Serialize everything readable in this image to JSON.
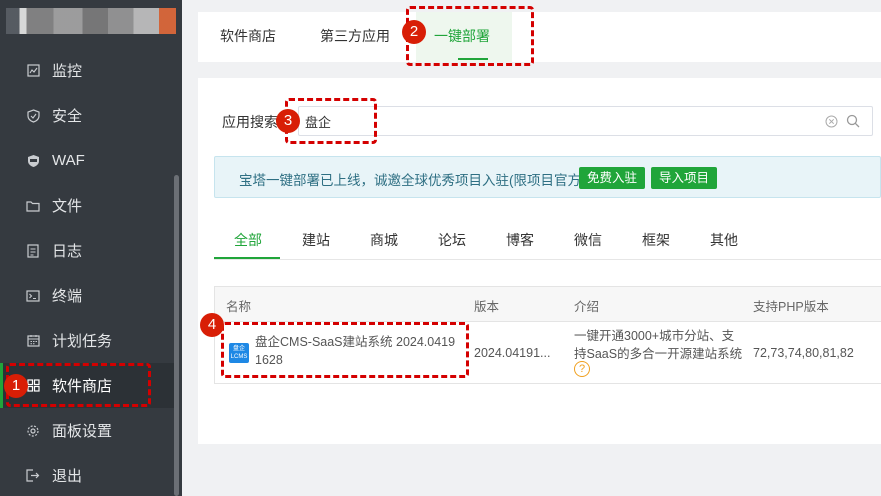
{
  "sidebar": {
    "items": [
      {
        "label": "监控",
        "icon": "monitor-icon"
      },
      {
        "label": "安全",
        "icon": "shield-icon"
      },
      {
        "label": "WAF",
        "icon": "waf-shield-icon"
      },
      {
        "label": "文件",
        "icon": "folder-icon"
      },
      {
        "label": "日志",
        "icon": "log-icon"
      },
      {
        "label": "终端",
        "icon": "terminal-icon"
      },
      {
        "label": "计划任务",
        "icon": "calendar-icon"
      },
      {
        "label": "软件商店",
        "icon": "grid-icon"
      },
      {
        "label": "面板设置",
        "icon": "gear-icon"
      },
      {
        "label": "退出",
        "icon": "logout-icon"
      }
    ]
  },
  "tabs": [
    {
      "label": "软件商店"
    },
    {
      "label": "第三方应用"
    },
    {
      "label": "一键部署"
    }
  ],
  "search": {
    "label": "应用搜索",
    "value": "盘企"
  },
  "notice": {
    "text": "宝塔一键部署已上线，诚邀全球优秀项目入驻(限项目官方)",
    "btn_join": "免费入驻",
    "btn_import": "导入项目"
  },
  "categories": [
    "全部",
    "建站",
    "商城",
    "论坛",
    "博客",
    "微信",
    "框架",
    "其他"
  ],
  "table": {
    "headers": [
      "名称",
      "版本",
      "介绍",
      "支持PHP版本"
    ],
    "rows": [
      {
        "logo_text": "盘企 LCMS",
        "name_line1": "盘企CMS-SaaS建站系统 2024.0419",
        "name_line2": "1628",
        "version": "2024.04191...",
        "intro_line1": "一键开通3000+城市分站、支",
        "intro_line2": "持SaaS的多合一开源建站系统",
        "help": "?",
        "php": "72,73,74,80,81,82"
      }
    ]
  },
  "annotations": [
    "1",
    "2",
    "3",
    "4"
  ],
  "colors": {
    "accent": "#20a53a",
    "sidebar": "#353a40",
    "annotation": "#d40000"
  }
}
